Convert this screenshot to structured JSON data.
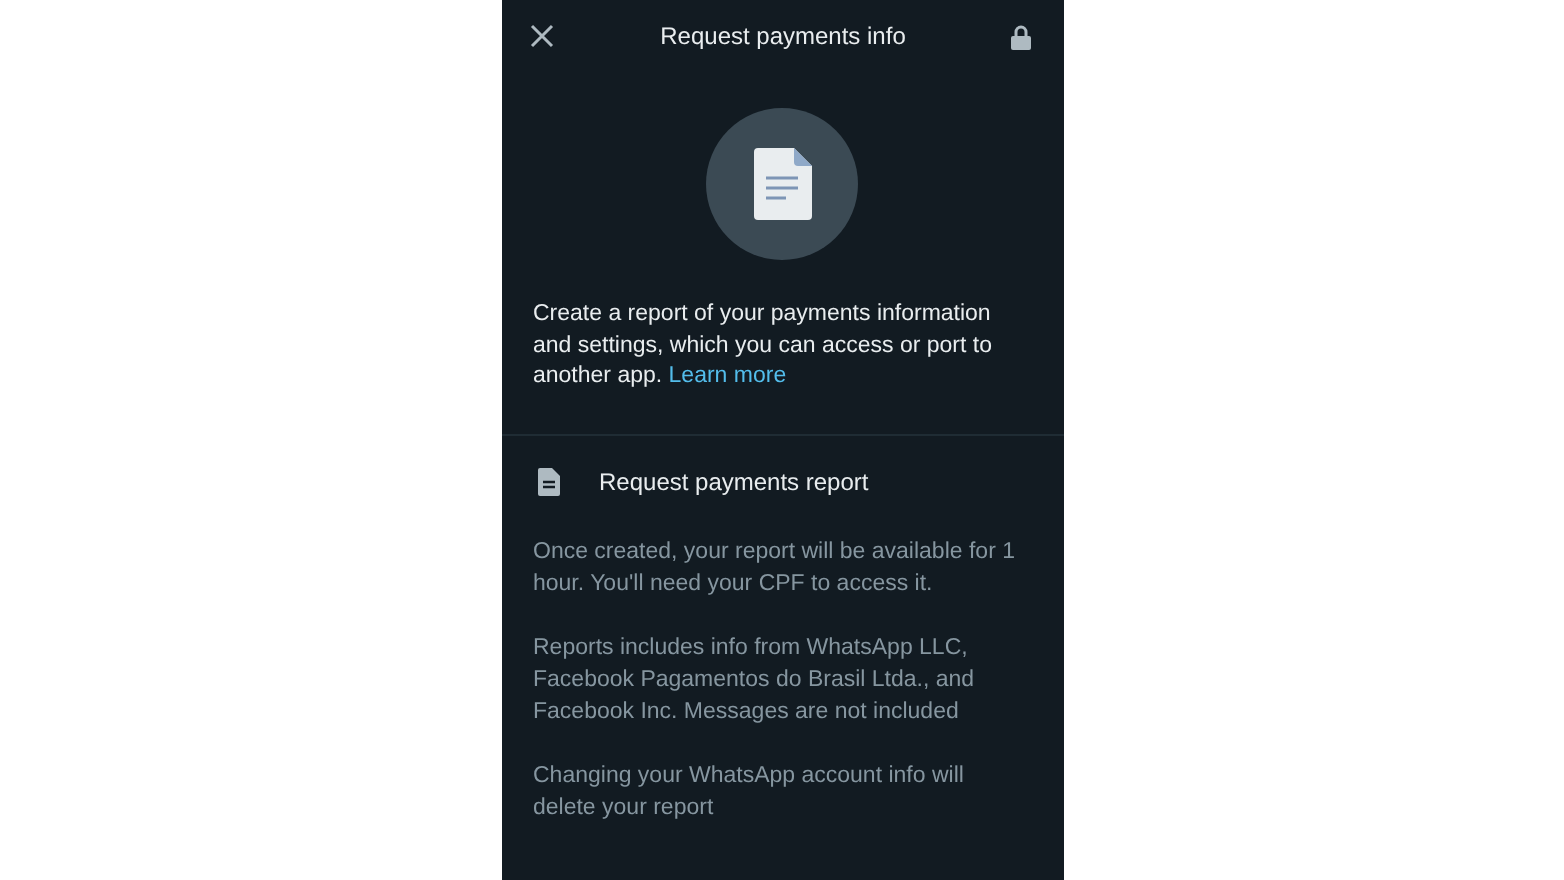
{
  "header": {
    "title": "Request payments info"
  },
  "intro": {
    "text": "Create a report of your payments information and settings, which you can access or port to another app.",
    "link": "Learn more"
  },
  "action": {
    "label": "Request payments report"
  },
  "notes": [
    "Once created, your report will be available for 1 hour. You'll need your CPF to access it.",
    "Reports includes info from WhatsApp LLC, Facebook Pagamentos do Brasil Ltda., and Facebook Inc. Messages are not included",
    "Changing your WhatsApp account info will delete your report"
  ]
}
